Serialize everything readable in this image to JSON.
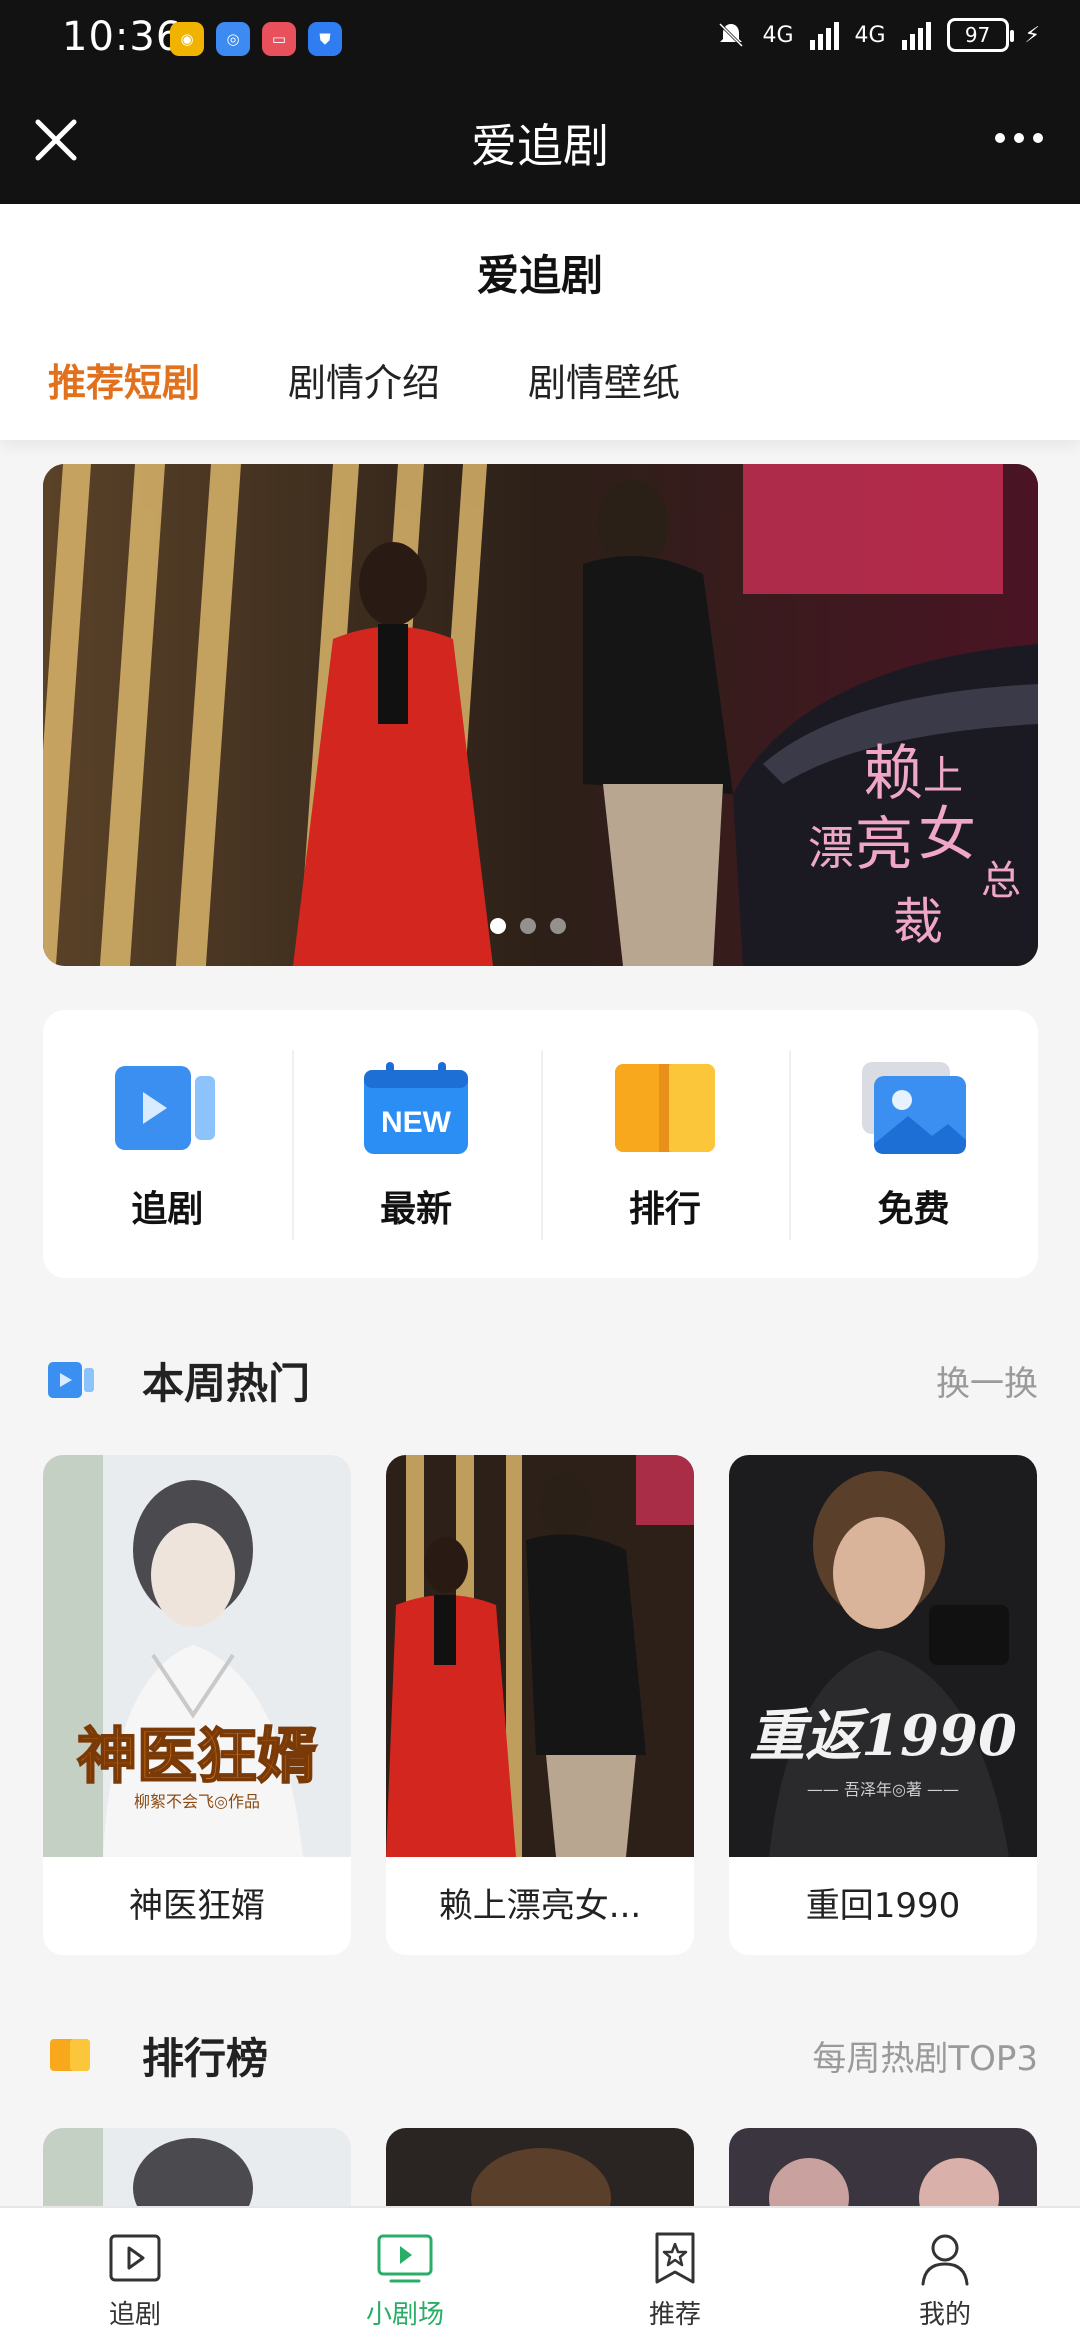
{
  "status_bar": {
    "time": "10:36",
    "network_1": "4G",
    "network_2": "4G",
    "battery": "97"
  },
  "app_bar": {
    "title": "爱追剧",
    "close_icon": "close-icon",
    "more_icon": "more-dots-icon"
  },
  "header": {
    "title": "爱追剧",
    "tabs": [
      {
        "label": "推荐短剧",
        "active": true
      },
      {
        "label": "剧情介绍",
        "active": false
      },
      {
        "label": "剧情壁纸",
        "active": false
      }
    ]
  },
  "banner": {
    "title_art": "赖上漂亮女总裁",
    "slide_count": 3,
    "active_slide": 1
  },
  "quick_nav": [
    {
      "label": "追剧",
      "icon": "video-play-icon",
      "color": "#3b8ff0"
    },
    {
      "label": "最新",
      "icon": "new-calendar-icon",
      "color": "#2b8ef5",
      "badge": "NEW"
    },
    {
      "label": "排行",
      "icon": "ranking-book-icon",
      "color": "#f7a81c"
    },
    {
      "label": "免费",
      "icon": "free-image-icon",
      "color": "#3b8ff0"
    }
  ],
  "hot_section": {
    "title": "本周热门",
    "link": "换一换",
    "items": [
      {
        "title": "神医狂婿",
        "cover_text": "神医狂婿",
        "cover_sub": "柳絮不会飞◎作品"
      },
      {
        "title": "赖上漂亮女...",
        "cover_text": "",
        "cover_sub": ""
      },
      {
        "title": "重回1990",
        "cover_text": "重返1990",
        "cover_sub": "—— 吾泽年◎著 ——"
      }
    ]
  },
  "rank_section": {
    "title": "排行榜",
    "link": "每周热剧TOP3"
  },
  "bottom_nav": [
    {
      "label": "追剧",
      "icon": "play-square-icon",
      "active": false
    },
    {
      "label": "小剧场",
      "icon": "tv-play-icon",
      "active": true
    },
    {
      "label": "推荐",
      "icon": "star-bookmark-icon",
      "active": false
    },
    {
      "label": "我的",
      "icon": "user-profile-icon",
      "active": false
    }
  ],
  "colors": {
    "accent_orange": "#e2711d",
    "accent_green": "#2aae67",
    "top_bar": "#121212"
  }
}
